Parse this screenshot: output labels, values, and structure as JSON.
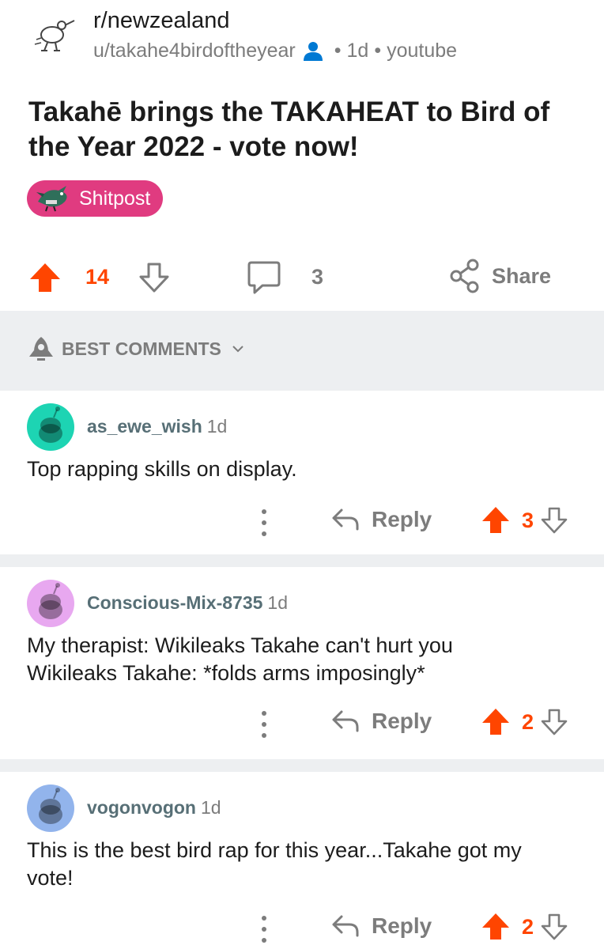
{
  "post": {
    "subreddit": "r/newzealand",
    "author": "u/takahe4birdoftheyear",
    "age": "1d",
    "domain": "youtube",
    "title": "Takahē brings the TAKAHEAT to Bird of the Year 2022 - vote now!",
    "flair": "Shitpost",
    "score": "14",
    "comments": "3",
    "share_label": "Share"
  },
  "sort": {
    "label": "BEST COMMENTS"
  },
  "colors": {
    "upvote": "#ff4500",
    "flair_bg": "#e03b80",
    "op_badge": "#0079d3",
    "divider": "#edeff1"
  },
  "comments": [
    {
      "author": "as_ewe_wish",
      "age": "1d",
      "body": [
        "Top rapping skills on display."
      ],
      "reply_label": "Reply",
      "score": "3",
      "avatar_color": "#1dd4b3"
    },
    {
      "author": "Conscious-Mix-8735",
      "age": "1d",
      "body": [
        "My therapist: Wikileaks Takahe can't hurt you",
        "Wikileaks Takahe: *folds arms imposingly*"
      ],
      "reply_label": "Reply",
      "score": "2",
      "avatar_color": "#e8a8f0"
    },
    {
      "author": "vogonvogon",
      "age": "1d",
      "body": [
        "This is the best bird rap for this year...Takahe got my",
        "vote!"
      ],
      "reply_label": "Reply",
      "score": "2",
      "avatar_color": "#92b4ec"
    }
  ]
}
